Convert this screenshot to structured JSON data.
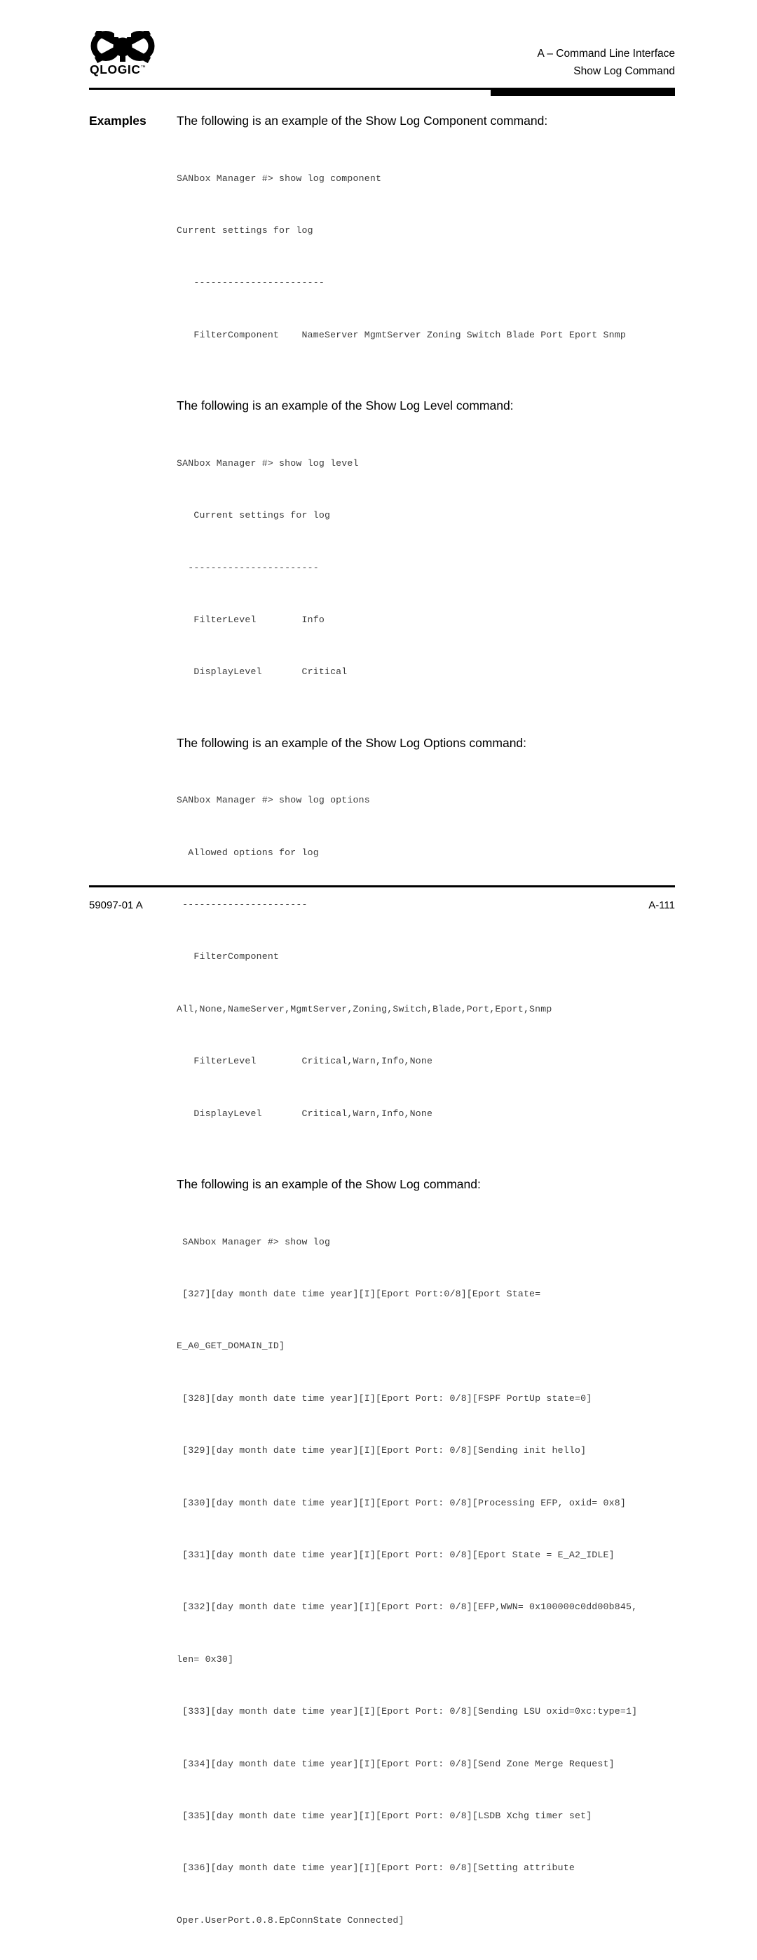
{
  "header": {
    "logo": {
      "wordmark": "QLOGIC",
      "trademark": "™",
      "icon": "qlogic-atom-logo"
    },
    "line1": "A – Command Line Interface",
    "line2": "Show Log Command"
  },
  "examples_label": "Examples",
  "sections": [
    {
      "heading": "The following is an example of the Show Log Component command:",
      "code": [
        "SANbox Manager #> show log component",
        "Current settings for log",
        "   -----------------------",
        "   FilterComponent    NameServer MgmtServer Zoning Switch Blade Port Eport Snmp"
      ]
    },
    {
      "heading": "The following is an example of the Show Log Level command:",
      "code": [
        "SANbox Manager #> show log level",
        "   Current settings for log",
        "  -----------------------",
        "   FilterLevel        Info",
        "   DisplayLevel       Critical"
      ]
    },
    {
      "heading": "The following is an example of the Show Log Options command:",
      "code": [
        "SANbox Manager #> show log options",
        "  Allowed options for log",
        " ----------------------",
        "   FilterComponent",
        "All,None,NameServer,MgmtServer,Zoning,Switch,Blade,Port,Eport,Snmp",
        "   FilterLevel        Critical,Warn,Info,None",
        "   DisplayLevel       Critical,Warn,Info,None"
      ]
    },
    {
      "heading": "The following is an example of the Show Log command:",
      "code": [
        " SANbox Manager #> show log",
        " [327][day month date time year][I][Eport Port:0/8][Eport State=",
        "E_A0_GET_DOMAIN_ID]",
        " [328][day month date time year][I][Eport Port: 0/8][FSPF PortUp state=0]",
        " [329][day month date time year][I][Eport Port: 0/8][Sending init hello]",
        " [330][day month date time year][I][Eport Port: 0/8][Processing EFP, oxid= 0x8]",
        " [331][day month date time year][I][Eport Port: 0/8][Eport State = E_A2_IDLE]",
        " [332][day month date time year][I][Eport Port: 0/8][EFP,WWN= 0x100000c0dd00b845,",
        "len= 0x30]",
        " [333][day month date time year][I][Eport Port: 0/8][Sending LSU oxid=0xc:type=1]",
        " [334][day month date time year][I][Eport Port: 0/8][Send Zone Merge Request]",
        " [335][day month date time year][I][Eport Port: 0/8][LSDB Xchg timer set]",
        " [336][day month date time year][I][Eport Port: 0/8][Setting attribute",
        "Oper.UserPort.0.8.EpConnState Connected]"
      ]
    }
  ],
  "footer": {
    "doc_number": "59097-01 A",
    "page_number": "A-111"
  },
  "colors": {
    "text": "#000000",
    "code_text": "#3a3a3a",
    "rule": "#000000",
    "background": "#ffffff"
  }
}
